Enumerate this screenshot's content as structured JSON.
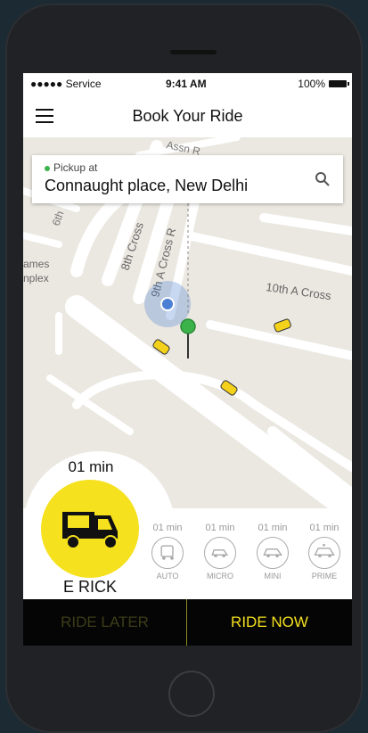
{
  "status": {
    "carrier": "●●●●● Service",
    "time": "9:41 AM",
    "battery": "100%"
  },
  "nav": {
    "title": "Book Your Ride"
  },
  "pickup": {
    "label": "Pickup at",
    "address": "Connaught place, New Delhi"
  },
  "map_labels": {
    "cross8": "8th Cross",
    "cross9": "9th A Cross R",
    "cross10": "10th A Cross",
    "james": "ames",
    "complex": "nplex",
    "assn": "Assn R"
  },
  "selected": {
    "eta": "01 min",
    "name": "E RICK"
  },
  "options": [
    {
      "eta": "01 min",
      "name": "AUTO",
      "icon": "auto-icon"
    },
    {
      "eta": "01 min",
      "name": "MICRO",
      "icon": "micro-car-icon"
    },
    {
      "eta": "01 min",
      "name": "MINI",
      "icon": "mini-car-icon"
    },
    {
      "eta": "01 min",
      "name": "PRIME",
      "icon": "prime-car-icon"
    }
  ],
  "actions": {
    "later": "RIDE LATER",
    "now": "RIDE NOW"
  },
  "colors": {
    "accent": "#f6e11e",
    "pin": "#3bb24a",
    "location": "#4a7fd4"
  }
}
